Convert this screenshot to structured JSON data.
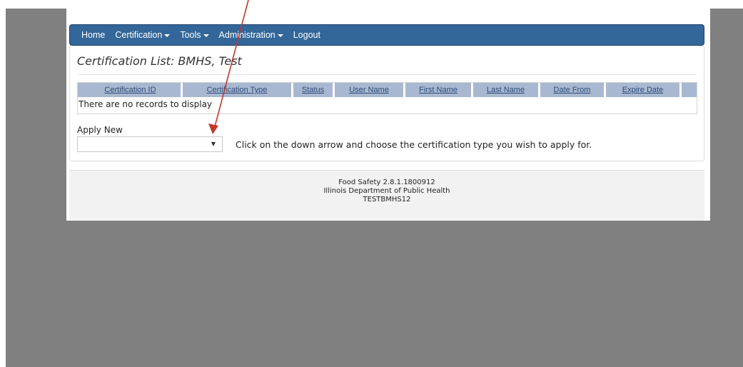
{
  "nav": {
    "home": "Home",
    "certification": "Certification",
    "tools": "Tools",
    "administration": "Administration",
    "logout": "Logout"
  },
  "page": {
    "title": "Certification List: BMHS, Test"
  },
  "grid": {
    "columns": [
      "Certification ID",
      "Certification Type",
      "Status",
      "User Name",
      "First Name",
      "Last Name",
      "Date From",
      "Expire Date"
    ],
    "empty_message": "There are no records to display"
  },
  "apply": {
    "label": "Apply New",
    "selected_value": "",
    "hint": "Click on the down arrow and choose the certification type you wish to apply for."
  },
  "footer": {
    "line1": "Food Safety 2.8.1.1800912",
    "line2": "Illinois Department of Public Health",
    "line3": "TESTBMHS12"
  },
  "colors": {
    "navbar": "#336699",
    "grid_header": "#a8b8d0",
    "annotation_arrow": "#c0392b",
    "background": "#808080"
  },
  "icons": {
    "dropdown_caret": "caret-down-icon",
    "select_arrow": "down-triangle-icon"
  }
}
